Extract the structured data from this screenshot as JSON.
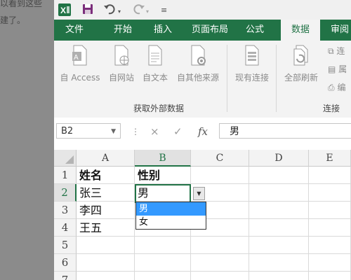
{
  "background": {
    "lines": [
      "以看到这些",
      "建了。"
    ]
  },
  "quick_access": {
    "app_icon": "excel-logo-icon",
    "save_icon": "save-icon",
    "undo_icon": "undo-icon",
    "redo_icon": "redo-icon",
    "customize_icon": "customize-qat-icon"
  },
  "ribbon_tabs": [
    "文件",
    "开始",
    "插入",
    "页面布局",
    "公式",
    "数据",
    "审阅"
  ],
  "active_tab": "数据",
  "ribbon": {
    "get_external_data": {
      "label": "获取外部数据",
      "buttons": [
        "自 Access",
        "自网站",
        "自文本",
        "自其他来源"
      ]
    },
    "existing_connections": "现有连接",
    "refresh_all": "全部刷新",
    "connections": {
      "label": "连接",
      "items": [
        "连",
        "属",
        "编"
      ]
    }
  },
  "formula_bar": {
    "name_box": "B2",
    "cancel_icon": "×",
    "enter_icon": "✓",
    "fx_label": "fx",
    "value": "男"
  },
  "sheet": {
    "columns": [
      "A",
      "B",
      "C",
      "D",
      "E"
    ],
    "rows": [
      "1",
      "2",
      "3",
      "4",
      "5",
      "6",
      "7"
    ],
    "cells": {
      "A1": "姓名",
      "B1": "性别",
      "A2": "张三",
      "B2": "男",
      "A3": "李四",
      "A4": "王五"
    },
    "active_cell": "B2"
  },
  "dropdown": {
    "options": [
      "男",
      "女"
    ],
    "highlighted": "男"
  },
  "colors": {
    "excel_green": "#217346",
    "highlight_blue": "#3399ff"
  }
}
